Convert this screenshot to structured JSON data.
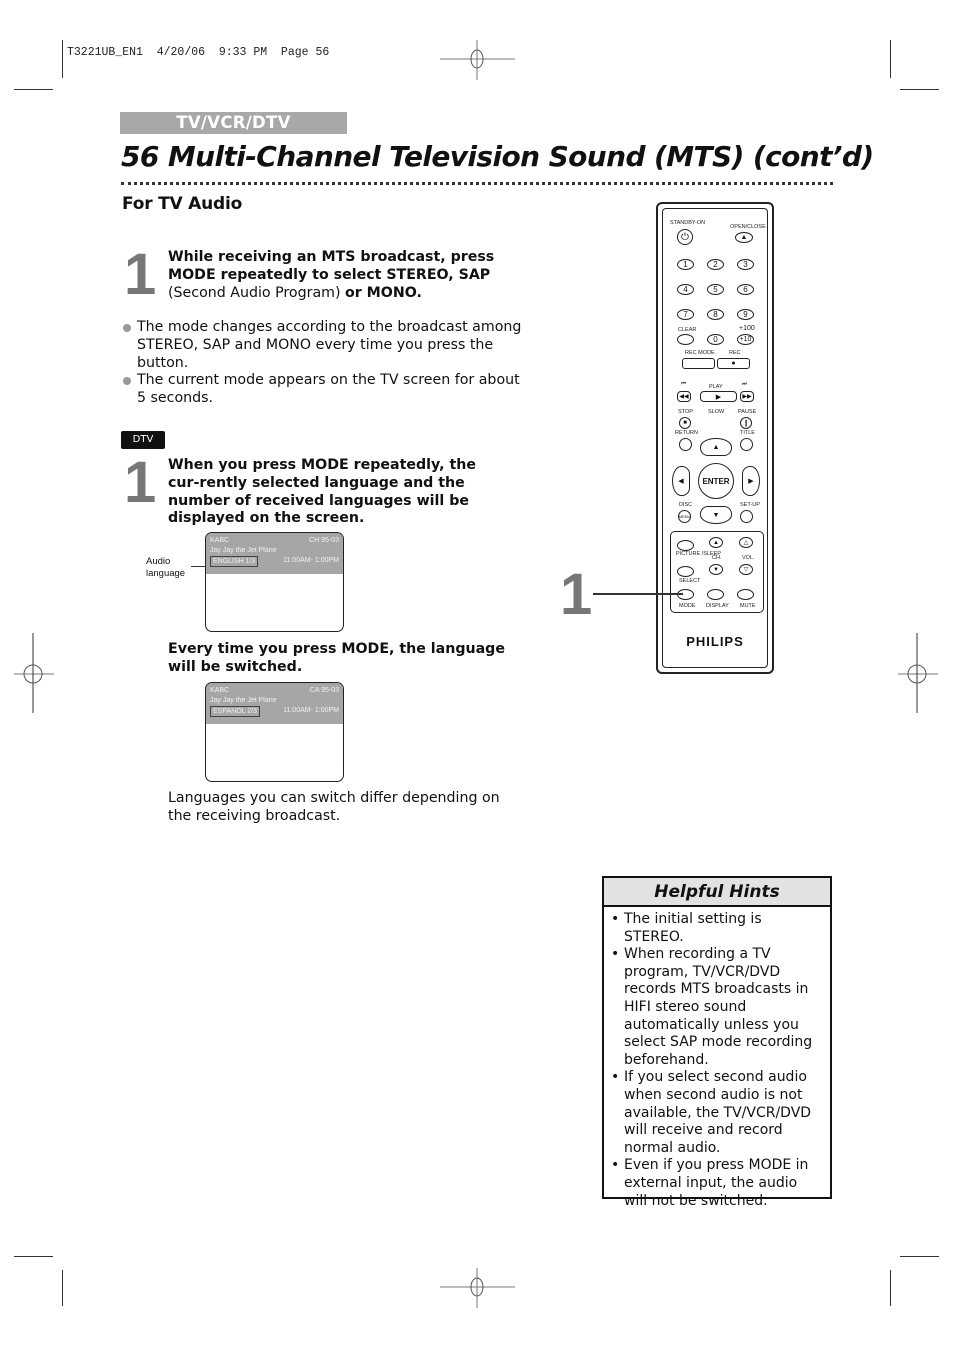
{
  "slug": "T3221UB_EN1  4/20/06  9:33 PM  Page 56",
  "section_tag": "TV/VCR/DTV",
  "page_title": "56  Multi-Channel Television Sound (MTS) (cont’d)",
  "subheading": "For TV Audio",
  "step1": {
    "number": "1",
    "bold_a": "While receiving an MTS broadcast, press MODE repeatedly to select STEREO, SAP",
    "normal": " (Second Audio Program) ",
    "bold_b": "or MONO."
  },
  "bullets": [
    "The mode changes according to the broadcast among STEREO, SAP and MONO every time you press the button.",
    "The current mode appears on the TV screen for about 5 seconds."
  ],
  "dtv_badge": "DTV",
  "dtv_step": {
    "number": "1",
    "text": "When you press MODE repeatedly, the cur-rently selected language and the number of received languages will be displayed on the screen."
  },
  "screen1": {
    "station": "KABC",
    "channel": "CH 95-03",
    "program": "Jay Jay the Jet Plane",
    "language": "ENGLISH 1/3",
    "time": "11:00AM- 1:00PM"
  },
  "callout": {
    "line1": "Audio",
    "line2": "language"
  },
  "switch_text": "Every time you press MODE, the language will be switched.",
  "screen2": {
    "station": "KABC",
    "channel": "CA 95-03",
    "program": "Jay Jay the Jet Plane",
    "language": "ESPANOL 2/3",
    "time": "11:00AM- 1:00PM"
  },
  "note": "Languages you can switch differ depending on the receiving broadcast.",
  "remote": {
    "standby_label": "STANDBY-ON",
    "openclose_label": "OPEN/CLOSE",
    "numbers": [
      "1",
      "2",
      "3",
      "4",
      "5",
      "6",
      "7",
      "8",
      "9"
    ],
    "clear_label": "CLEAR",
    "zero": "0",
    "plus100_label": "+100",
    "plus10": "+10",
    "recmode_label": "REC MODE",
    "rec_label": "REC",
    "play_label": "PLAY",
    "stop_label": "STOP",
    "slow_label": "SLOW",
    "pause_label": "PAUSE",
    "return_label": "RETURN",
    "title_label": "TITLE",
    "enter_label": "ENTER",
    "disc_label": "DISC",
    "menu_label": "MENU",
    "setup_label": "SET-UP",
    "picture_label": "PICTURE /SLEEP",
    "ch_label": "CH.",
    "vol_label": "VOL.",
    "select_label": "SELECT",
    "mode_label": "MODE",
    "display_label": "DISPLAY",
    "mute_label": "MUTE",
    "brand": "PHILIPS"
  },
  "remote_step_number": "1",
  "hints": {
    "title": "Helpful Hints",
    "items": [
      "The initial setting is STEREO.",
      "When recording a TV program, TV/VCR/DVD records MTS broadcasts in HIFI stereo sound automatically unless you select SAP mode recording beforehand.",
      "If you select second audio when second audio is not available, the TV/VCR/DVD will receive and record normal audio.",
      "Even if you press MODE in external input, the audio will not be switched."
    ]
  }
}
